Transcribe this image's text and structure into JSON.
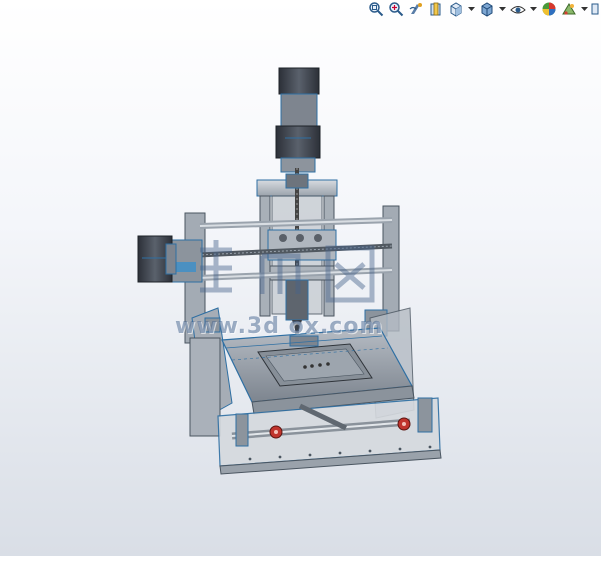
{
  "toolbar": {
    "icons": [
      "zoom-to-fit-icon",
      "zoom-to-area-icon",
      "previous-view-icon",
      "section-view-icon",
      "view-orientation-icon",
      "display-style-icon",
      "hide-show-items-icon",
      "edit-appearance-icon",
      "apply-scene-icon",
      "view-settings-icon"
    ]
  },
  "watermark": {
    "domain": "www.3d  ox.com"
  },
  "colors": {
    "frame": "#9aa3ad",
    "edge": "#2e6fa3",
    "motor": "#3a3f47",
    "rail": "#b8c0c8",
    "bed": "#c9ced4",
    "accent_red": "#c0342d"
  }
}
